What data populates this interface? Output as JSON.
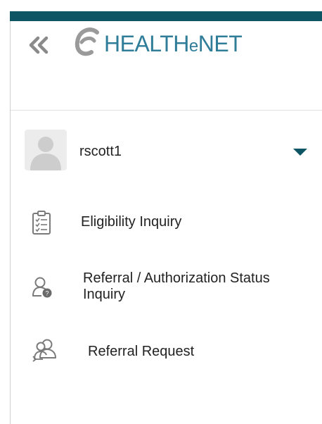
{
  "app": {
    "logo_text_prefix": "HEALTH",
    "logo_text_e": "e",
    "logo_text_suffix": "NET",
    "brand_color": "#2f7d98",
    "top_bar_color": "#0d5565"
  },
  "header": {
    "collapse_icon": "double-chevron-left-icon"
  },
  "user": {
    "username": "rscott1",
    "avatar_icon": "user-placeholder-icon",
    "dropdown_icon": "caret-down-icon"
  },
  "menu": {
    "items": [
      {
        "label": "Eligibility Inquiry",
        "icon": "clipboard-checklist-icon"
      },
      {
        "label": "Referral / Authorization Status Inquiry",
        "icon": "user-question-icon"
      },
      {
        "label": "Referral Request",
        "icon": "users-arrow-icon"
      }
    ]
  }
}
